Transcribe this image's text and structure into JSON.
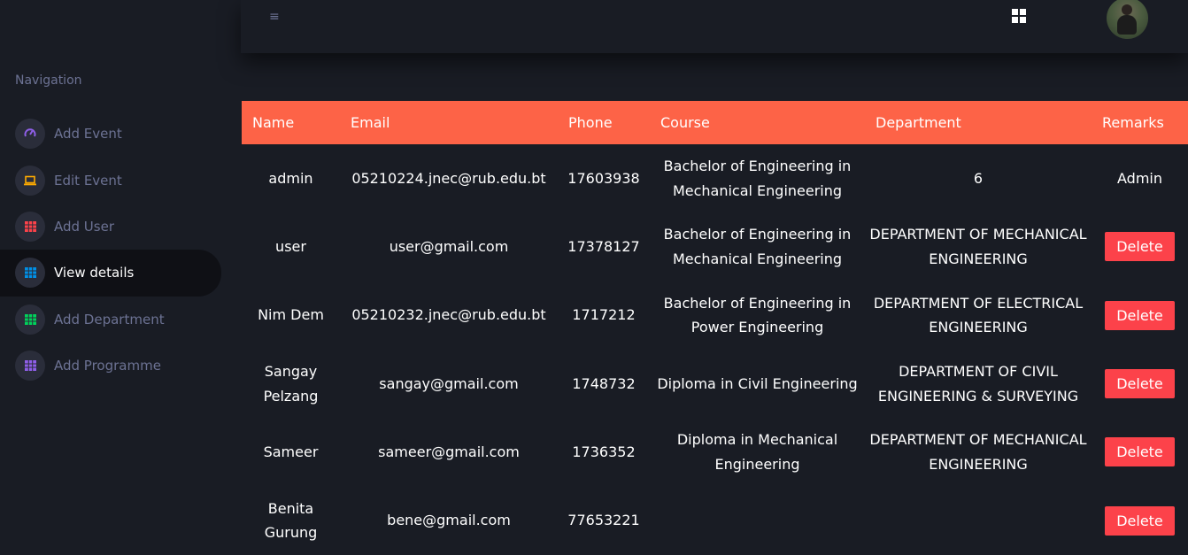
{
  "sidebar": {
    "title": "Navigation",
    "items": [
      {
        "label": "Add Event",
        "icon": "speedometer-icon",
        "color": "#8f5fe8"
      },
      {
        "label": "Edit Event",
        "icon": "laptop-icon",
        "color": "#ffab00"
      },
      {
        "label": "Add User",
        "icon": "table-icon",
        "color": "#fc424a"
      },
      {
        "label": "View details",
        "icon": "table-icon",
        "color": "#0090e7",
        "active": true
      },
      {
        "label": "Add Department",
        "icon": "table-icon",
        "color": "#00d25b"
      },
      {
        "label": "Add Programme",
        "icon": "table-icon",
        "color": "#8f5fe8"
      }
    ]
  },
  "topbar": {
    "menu_icon": "hamburger-icon",
    "apps_icon": "grid-icon"
  },
  "table": {
    "headers": [
      "Name",
      "Email",
      "Phone",
      "Course",
      "Department",
      "Remarks"
    ],
    "rows": [
      {
        "name": "admin",
        "email": "05210224.jnec@rub.edu.bt",
        "phone": "17603938",
        "course": "Bachelor of Engineering in Mechanical Engineering",
        "department": "6",
        "remarks": "Admin"
      },
      {
        "name": "user",
        "email": "user@gmail.com",
        "phone": "17378127",
        "course": "Bachelor of Engineering in Mechanical Engineering",
        "department": "DEPARTMENT OF MECHANICAL ENGINEERING",
        "remarks": "Delete"
      },
      {
        "name": "Nim Dem",
        "email": "05210232.jnec@rub.edu.bt",
        "phone": "1717212",
        "course": "Bachelor of Engineering in Power Engineering",
        "department": "DEPARTMENT OF ELECTRICAL ENGINEERING",
        "remarks": "Delete"
      },
      {
        "name": "Sangay Pelzang",
        "email": "sangay@gmail.com",
        "phone": "1748732",
        "course": "Diploma in Civil Engineering",
        "department": "DEPARTMENT OF CIVIL ENGINEERING & SURVEYING",
        "remarks": "Delete"
      },
      {
        "name": "Sameer",
        "email": "sameer@gmail.com",
        "phone": "1736352",
        "course": "Diploma in Mechanical Engineering",
        "department": "DEPARTMENT OF MECHANICAL ENGINEERING",
        "remarks": "Delete"
      },
      {
        "name": "Benita Gurung",
        "email": "bene@gmail.com",
        "phone": "77653221",
        "course": "",
        "department": "",
        "remarks": "Delete"
      }
    ]
  },
  "colors": {
    "background": "#191c24",
    "header_accent": "#fd6347",
    "delete_button": "#fc424a",
    "muted_text": "#6c7293"
  }
}
